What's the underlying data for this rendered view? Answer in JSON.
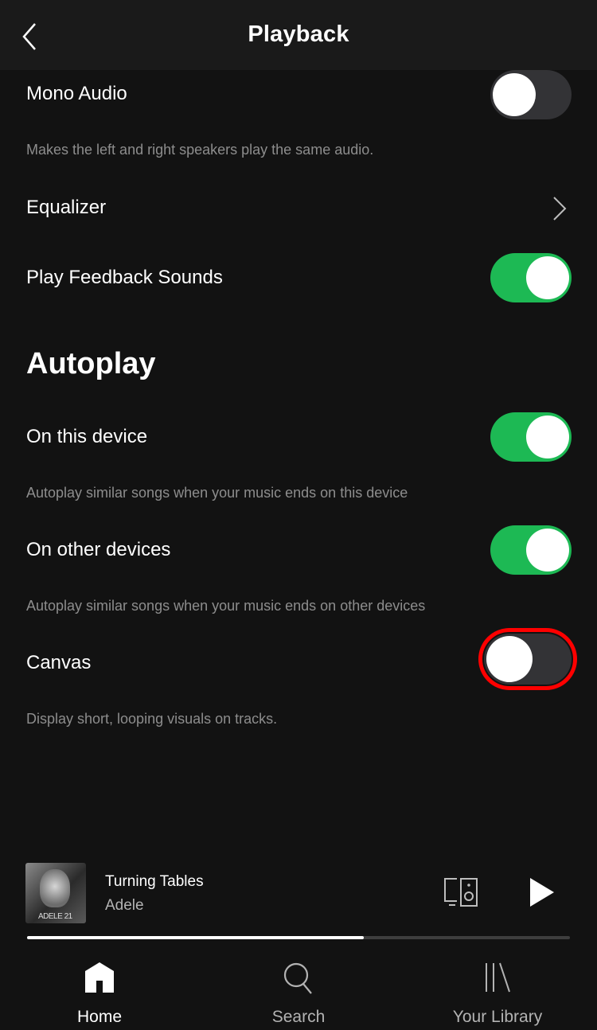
{
  "header": {
    "title": "Playback",
    "back_icon": "chevron-left-icon"
  },
  "settings": {
    "mono_audio": {
      "label": "Mono Audio",
      "description": "Makes the left and right speakers play the same audio.",
      "enabled": false
    },
    "equalizer": {
      "label": "Equalizer",
      "icon": "chevron-right-icon"
    },
    "play_feedback_sounds": {
      "label": "Play Feedback Sounds",
      "enabled": true
    },
    "autoplay_section": {
      "title": "Autoplay"
    },
    "on_this_device": {
      "label": "On this device",
      "description": "Autoplay similar songs when your music ends on this device",
      "enabled": true
    },
    "on_other_devices": {
      "label": "On other devices",
      "description": "Autoplay similar songs when your music ends on other devices",
      "enabled": true
    },
    "canvas": {
      "label": "Canvas",
      "description": "Display short, looping visuals on tracks.",
      "enabled": false,
      "highlighted": true
    }
  },
  "now_playing": {
    "album_art_text": "ADELE 21",
    "track": "Turning Tables",
    "artist": "Adele",
    "progress_percent": 62,
    "devices_icon": "devices-icon",
    "play_icon": "play-icon"
  },
  "bottom_nav": {
    "items": [
      {
        "label": "Home",
        "icon": "home-icon",
        "active": true
      },
      {
        "label": "Search",
        "icon": "search-icon",
        "active": false
      },
      {
        "label": "Your Library",
        "icon": "library-icon",
        "active": false
      }
    ]
  },
  "colors": {
    "accent_green": "#1db954",
    "highlight_red": "#ff0000",
    "background": "#121212",
    "header_bg": "#1a1a1a"
  }
}
